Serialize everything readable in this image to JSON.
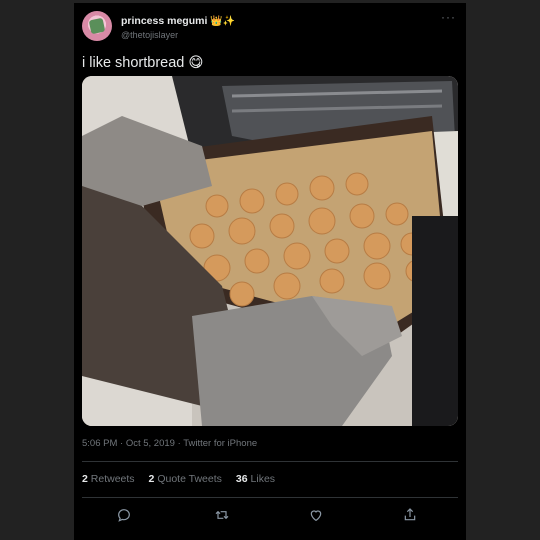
{
  "tweet": {
    "display_name": "princess megumi",
    "name_emojis": "👑✨",
    "handle": "@thetojislayer",
    "text": "i like shortbread",
    "text_emoji": "😋",
    "timestamp": "5:06 PM · Oct 5, 2019",
    "source": "Twitter for iPhone",
    "stats": {
      "retweets_count": "2",
      "retweets_label": "Retweets",
      "quotes_count": "2",
      "quotes_label": "Quote Tweets",
      "likes_count": "36",
      "likes_label": "Likes"
    },
    "more_glyph": "···"
  },
  "icons": {
    "more": "more-horizontal-icon",
    "reply": "reply-icon",
    "retweet": "retweet-icon",
    "like": "heart-icon",
    "share": "share-icon"
  },
  "colors": {
    "background": "#000000",
    "text_primary": "#e7e9ea",
    "text_secondary": "#71767b",
    "divider": "#2f3336"
  }
}
